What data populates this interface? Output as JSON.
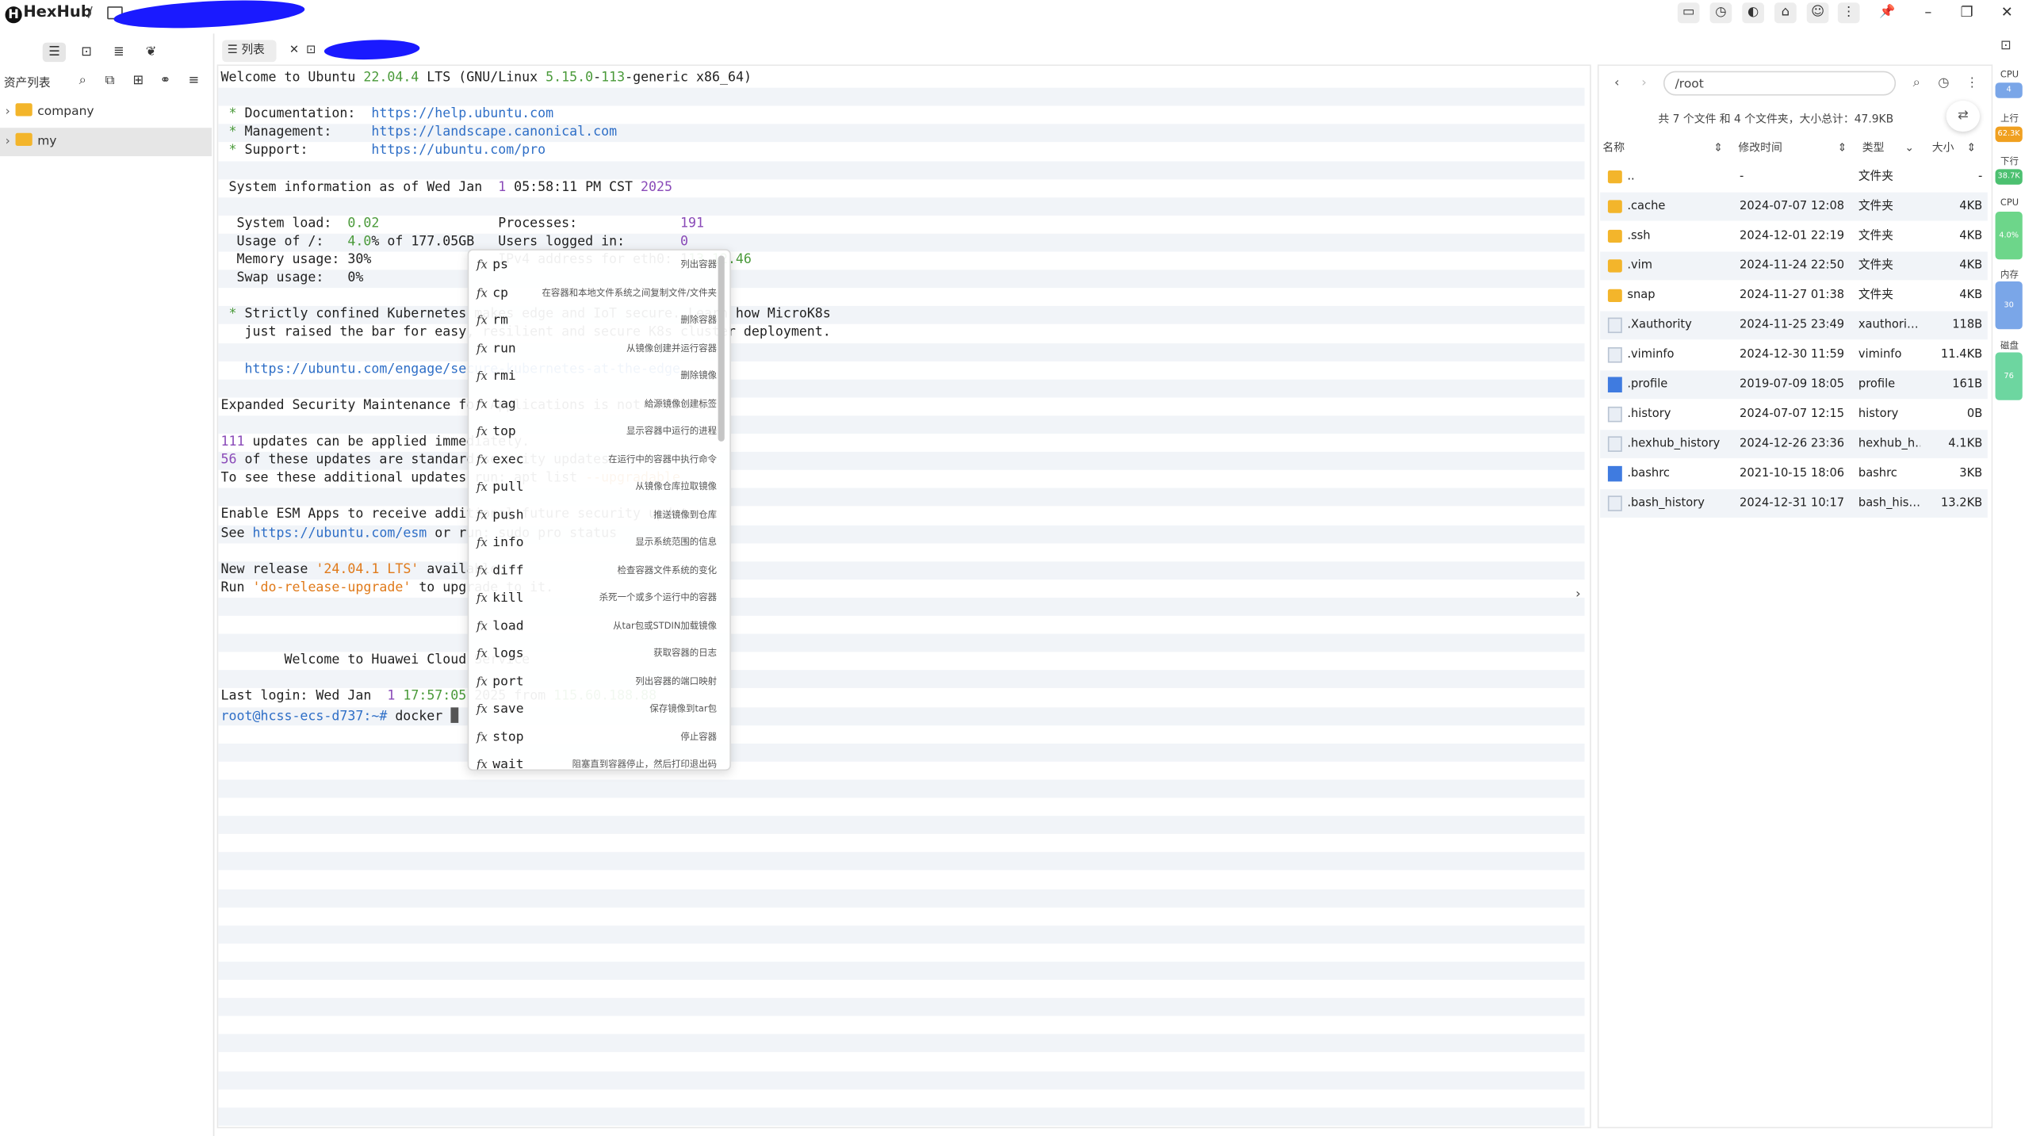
{
  "app": {
    "name": "HexHub",
    "separator": "/"
  },
  "sidebar": {
    "header_label": "资产列表",
    "tree": [
      {
        "label": "company",
        "selected": false
      },
      {
        "label": "my",
        "selected": true
      }
    ]
  },
  "tabs": [
    {
      "label": "列表",
      "icon": "list-icon"
    },
    {
      "label": "",
      "icon": "terminal-icon",
      "closable": true
    }
  ],
  "terminal": {
    "lines": [
      [
        {
          "t": "Welcome to Ubuntu "
        },
        {
          "t": "22.04.4",
          "c": "g"
        },
        {
          "t": " LTS (GNU/Linux "
        },
        {
          "t": "5.15.0",
          "c": "g"
        },
        {
          "t": "-"
        },
        {
          "t": "113",
          "c": "g"
        },
        {
          "t": "-generic x86_64)"
        }
      ],
      [],
      [
        {
          "t": " * ",
          "c": "g"
        },
        {
          "t": "Documentation:  "
        },
        {
          "t": "https://help.ubuntu.com",
          "c": "b"
        }
      ],
      [
        {
          "t": " * ",
          "c": "g"
        },
        {
          "t": "Management:     "
        },
        {
          "t": "https://landscape.canonical.com",
          "c": "b"
        }
      ],
      [
        {
          "t": " * ",
          "c": "g"
        },
        {
          "t": "Support:        "
        },
        {
          "t": "https://ubuntu.com/pro",
          "c": "b"
        }
      ],
      [],
      [
        {
          "t": " System information as of Wed Jan  "
        },
        {
          "t": "1",
          "c": "p"
        },
        {
          "t": " 05:58:11 PM CST "
        },
        {
          "t": "2025",
          "c": "p"
        }
      ],
      [],
      [
        {
          "t": "  System load:  "
        },
        {
          "t": "0.02",
          "c": "g"
        },
        {
          "t": "               Processes:             "
        },
        {
          "t": "191",
          "c": "p"
        }
      ],
      [
        {
          "t": "  Usage of /:   "
        },
        {
          "t": "4.0",
          "c": "g"
        },
        {
          "t": "% of 177.05GB   Users logged in:       "
        },
        {
          "t": "0",
          "c": "p"
        }
      ],
      [
        {
          "t": "  Memory usage: 30%                IPv4 address for eth0: 1"
        },
        {
          "t": "13.12.46",
          "c": "g"
        }
      ],
      [
        {
          "t": "  Swap usage:   0%"
        }
      ],
      [],
      [
        {
          "t": " * ",
          "c": "g"
        },
        {
          "t": "Strictly confined Kubernetes makes edge and IoT secure. Learn how MicroK8s"
        }
      ],
      [
        {
          "t": "   just raised the bar for easy, resilient and secure K8s cluster deployment."
        }
      ],
      [],
      [
        {
          "t": "   "
        },
        {
          "t": "https://ubuntu.com/engage/secure-kubernetes-at-the-edge",
          "c": "b"
        }
      ],
      [],
      [
        {
          "t": "Expanded Security Maintenance for Applications is not enabled."
        }
      ],
      [],
      [
        {
          "t": "111",
          "c": "p"
        },
        {
          "t": " updates can be applied immediately."
        }
      ],
      [
        {
          "t": "56",
          "c": "p"
        },
        {
          "t": " of these updates are standard security updates."
        }
      ],
      [
        {
          "t": "To see these additional updates run: apt list "
        },
        {
          "t": "--upgradable",
          "c": "o"
        }
      ],
      [],
      [
        {
          "t": "Enable ESM Apps to receive additional future security updates."
        }
      ],
      [
        {
          "t": "See "
        },
        {
          "t": "https://ubuntu.com/esm",
          "c": "b"
        },
        {
          "t": " or run: sudo pro status"
        }
      ],
      [],
      [
        {
          "t": "New release "
        },
        {
          "t": "'24.04.1 LTS'",
          "c": "o"
        },
        {
          "t": " available."
        }
      ],
      [
        {
          "t": "Run "
        },
        {
          "t": "'do-release-upgrade'",
          "c": "o"
        },
        {
          "t": " to upgrade to it."
        }
      ],
      [],
      [],
      [],
      [
        {
          "t": "        Welcome to Huawei Cloud Service"
        }
      ],
      [],
      [
        {
          "t": "Last login: Wed Jan  "
        },
        {
          "t": "1",
          "c": "p"
        },
        {
          "t": " "
        },
        {
          "t": "17:57:05",
          "c": "g"
        },
        {
          "t": " 2025 from "
        },
        {
          "t": "115.60.188.88",
          "c": "g"
        }
      ],
      [
        {
          "t": "root@hcss-ecs-d737:~# ",
          "c": "b"
        },
        {
          "t": "docker "
        }
      ]
    ]
  },
  "completion": {
    "items": [
      {
        "cmd": "ps",
        "desc": "列出容器"
      },
      {
        "cmd": "cp",
        "desc": "在容器和本地文件系统之间复制文件/文件夹"
      },
      {
        "cmd": "rm",
        "desc": "删除容器"
      },
      {
        "cmd": "run",
        "desc": "从镜像创建并运行容器"
      },
      {
        "cmd": "rmi",
        "desc": "删除镜像"
      },
      {
        "cmd": "tag",
        "desc": "給源镜像创建标签"
      },
      {
        "cmd": "top",
        "desc": "显示容器中运行的进程"
      },
      {
        "cmd": "exec",
        "desc": "在运行中的容器中执行命令"
      },
      {
        "cmd": "pull",
        "desc": "从镜像仓库拉取镜像"
      },
      {
        "cmd": "push",
        "desc": "推送镜像到仓库"
      },
      {
        "cmd": "info",
        "desc": "显示系统范围的信息"
      },
      {
        "cmd": "diff",
        "desc": "检查容器文件系统的变化"
      },
      {
        "cmd": "kill",
        "desc": "杀死一个或多个运行中的容器"
      },
      {
        "cmd": "load",
        "desc": "从tar包或STDIN加载镜像"
      },
      {
        "cmd": "logs",
        "desc": "获取容器的日志"
      },
      {
        "cmd": "port",
        "desc": "列出容器的端口映射"
      },
      {
        "cmd": "save",
        "desc": "保存镜像到tar包"
      },
      {
        "cmd": "stop",
        "desc": "停止容器"
      },
      {
        "cmd": "wait",
        "desc": "阻塞直到容器停止，然后打印退出码"
      }
    ]
  },
  "files": {
    "path": "/root",
    "summary": "共 7 个文件 和 4 个文件夹，大小总计：47.9KB",
    "columns": {
      "name": "名称",
      "mtime": "修改时间",
      "type": "类型",
      "size": "大小"
    },
    "rows": [
      {
        "name": "..",
        "mtime": "-",
        "type": "文件夹",
        "size": "-",
        "kind": "dir"
      },
      {
        "name": ".cache",
        "mtime": "2024-07-07 12:08",
        "type": "文件夹",
        "size": "4KB",
        "kind": "dir"
      },
      {
        "name": ".ssh",
        "mtime": "2024-12-01 22:19",
        "type": "文件夹",
        "size": "4KB",
        "kind": "dir"
      },
      {
        "name": ".vim",
        "mtime": "2024-11-24 22:50",
        "type": "文件夹",
        "size": "4KB",
        "kind": "dir"
      },
      {
        "name": "snap",
        "mtime": "2024-11-27 01:38",
        "type": "文件夹",
        "size": "4KB",
        "kind": "dir"
      },
      {
        "name": ".Xauthority",
        "mtime": "2024-11-25 23:49",
        "type": "xauthori…",
        "size": "118B",
        "kind": "doc"
      },
      {
        "name": ".viminfo",
        "mtime": "2024-12-30 11:59",
        "type": "viminfo",
        "size": "11.4KB",
        "kind": "doc"
      },
      {
        "name": ".profile",
        "mtime": "2019-07-09 18:05",
        "type": "profile",
        "size": "161B",
        "kind": "docb"
      },
      {
        "name": ".history",
        "mtime": "2024-07-07 12:15",
        "type": "history",
        "size": "0B",
        "kind": "doc"
      },
      {
        "name": ".hexhub_history",
        "mtime": "2024-12-26 23:36",
        "type": "hexhub_h…",
        "size": "4.1KB",
        "kind": "doc"
      },
      {
        "name": ".bashrc",
        "mtime": "2021-10-15 18:06",
        "type": "bashrc",
        "size": "3KB",
        "kind": "docb"
      },
      {
        "name": ".bash_history",
        "mtime": "2024-12-31 10:17",
        "type": "bash_his…",
        "size": "13.2KB",
        "kind": "doc"
      }
    ]
  },
  "monitor": {
    "cpu_label": "CPU",
    "cpu_value": "4",
    "up_label": "上行",
    "up_value": "62.3K",
    "down_label": "下行",
    "down_value": "38.7K",
    "cpu2_label": "CPU",
    "cpu2_value": "4.0%",
    "mem_label": "内存",
    "mem_value": "30",
    "disk_label": "磁盘",
    "disk_value": "76",
    "colors": {
      "cpu": "#7aa6e8",
      "up": "#f0a020",
      "down": "#4cc070",
      "mem": "#7aa6e8",
      "disk": "#6dd6a0"
    }
  }
}
